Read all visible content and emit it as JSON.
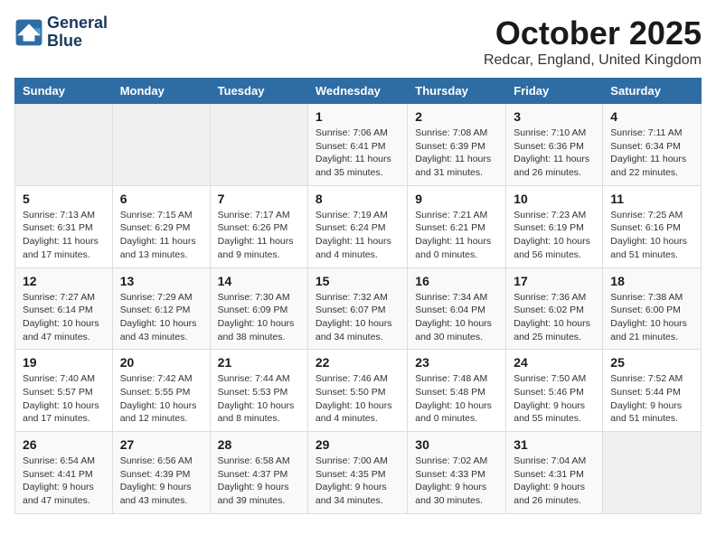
{
  "header": {
    "logo_line1": "General",
    "logo_line2": "Blue",
    "month": "October 2025",
    "location": "Redcar, England, United Kingdom"
  },
  "days_of_week": [
    "Sunday",
    "Monday",
    "Tuesday",
    "Wednesday",
    "Thursday",
    "Friday",
    "Saturday"
  ],
  "weeks": [
    [
      {
        "day": "",
        "info": ""
      },
      {
        "day": "",
        "info": ""
      },
      {
        "day": "",
        "info": ""
      },
      {
        "day": "1",
        "info": "Sunrise: 7:06 AM\nSunset: 6:41 PM\nDaylight: 11 hours and 35 minutes."
      },
      {
        "day": "2",
        "info": "Sunrise: 7:08 AM\nSunset: 6:39 PM\nDaylight: 11 hours and 31 minutes."
      },
      {
        "day": "3",
        "info": "Sunrise: 7:10 AM\nSunset: 6:36 PM\nDaylight: 11 hours and 26 minutes."
      },
      {
        "day": "4",
        "info": "Sunrise: 7:11 AM\nSunset: 6:34 PM\nDaylight: 11 hours and 22 minutes."
      }
    ],
    [
      {
        "day": "5",
        "info": "Sunrise: 7:13 AM\nSunset: 6:31 PM\nDaylight: 11 hours and 17 minutes."
      },
      {
        "day": "6",
        "info": "Sunrise: 7:15 AM\nSunset: 6:29 PM\nDaylight: 11 hours and 13 minutes."
      },
      {
        "day": "7",
        "info": "Sunrise: 7:17 AM\nSunset: 6:26 PM\nDaylight: 11 hours and 9 minutes."
      },
      {
        "day": "8",
        "info": "Sunrise: 7:19 AM\nSunset: 6:24 PM\nDaylight: 11 hours and 4 minutes."
      },
      {
        "day": "9",
        "info": "Sunrise: 7:21 AM\nSunset: 6:21 PM\nDaylight: 11 hours and 0 minutes."
      },
      {
        "day": "10",
        "info": "Sunrise: 7:23 AM\nSunset: 6:19 PM\nDaylight: 10 hours and 56 minutes."
      },
      {
        "day": "11",
        "info": "Sunrise: 7:25 AM\nSunset: 6:16 PM\nDaylight: 10 hours and 51 minutes."
      }
    ],
    [
      {
        "day": "12",
        "info": "Sunrise: 7:27 AM\nSunset: 6:14 PM\nDaylight: 10 hours and 47 minutes."
      },
      {
        "day": "13",
        "info": "Sunrise: 7:29 AM\nSunset: 6:12 PM\nDaylight: 10 hours and 43 minutes."
      },
      {
        "day": "14",
        "info": "Sunrise: 7:30 AM\nSunset: 6:09 PM\nDaylight: 10 hours and 38 minutes."
      },
      {
        "day": "15",
        "info": "Sunrise: 7:32 AM\nSunset: 6:07 PM\nDaylight: 10 hours and 34 minutes."
      },
      {
        "day": "16",
        "info": "Sunrise: 7:34 AM\nSunset: 6:04 PM\nDaylight: 10 hours and 30 minutes."
      },
      {
        "day": "17",
        "info": "Sunrise: 7:36 AM\nSunset: 6:02 PM\nDaylight: 10 hours and 25 minutes."
      },
      {
        "day": "18",
        "info": "Sunrise: 7:38 AM\nSunset: 6:00 PM\nDaylight: 10 hours and 21 minutes."
      }
    ],
    [
      {
        "day": "19",
        "info": "Sunrise: 7:40 AM\nSunset: 5:57 PM\nDaylight: 10 hours and 17 minutes."
      },
      {
        "day": "20",
        "info": "Sunrise: 7:42 AM\nSunset: 5:55 PM\nDaylight: 10 hours and 12 minutes."
      },
      {
        "day": "21",
        "info": "Sunrise: 7:44 AM\nSunset: 5:53 PM\nDaylight: 10 hours and 8 minutes."
      },
      {
        "day": "22",
        "info": "Sunrise: 7:46 AM\nSunset: 5:50 PM\nDaylight: 10 hours and 4 minutes."
      },
      {
        "day": "23",
        "info": "Sunrise: 7:48 AM\nSunset: 5:48 PM\nDaylight: 10 hours and 0 minutes."
      },
      {
        "day": "24",
        "info": "Sunrise: 7:50 AM\nSunset: 5:46 PM\nDaylight: 9 hours and 55 minutes."
      },
      {
        "day": "25",
        "info": "Sunrise: 7:52 AM\nSunset: 5:44 PM\nDaylight: 9 hours and 51 minutes."
      }
    ],
    [
      {
        "day": "26",
        "info": "Sunrise: 6:54 AM\nSunset: 4:41 PM\nDaylight: 9 hours and 47 minutes."
      },
      {
        "day": "27",
        "info": "Sunrise: 6:56 AM\nSunset: 4:39 PM\nDaylight: 9 hours and 43 minutes."
      },
      {
        "day": "28",
        "info": "Sunrise: 6:58 AM\nSunset: 4:37 PM\nDaylight: 9 hours and 39 minutes."
      },
      {
        "day": "29",
        "info": "Sunrise: 7:00 AM\nSunset: 4:35 PM\nDaylight: 9 hours and 34 minutes."
      },
      {
        "day": "30",
        "info": "Sunrise: 7:02 AM\nSunset: 4:33 PM\nDaylight: 9 hours and 30 minutes."
      },
      {
        "day": "31",
        "info": "Sunrise: 7:04 AM\nSunset: 4:31 PM\nDaylight: 9 hours and 26 minutes."
      },
      {
        "day": "",
        "info": ""
      }
    ]
  ]
}
